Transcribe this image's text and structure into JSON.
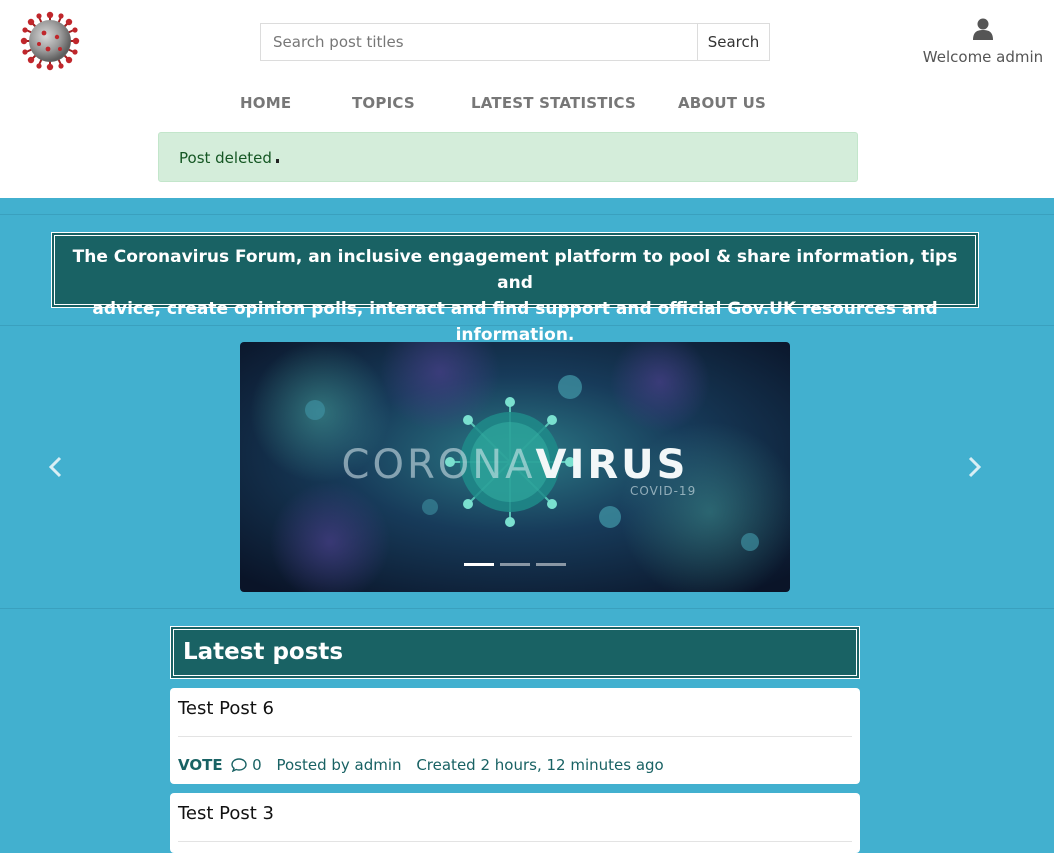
{
  "header": {
    "logo_icon": "coronavirus-logo-icon",
    "search": {
      "placeholder": "Search post titles",
      "value": "",
      "button_label": "Search"
    },
    "user": {
      "icon": "user-icon",
      "welcome_text": "Welcome admin"
    }
  },
  "nav": {
    "items": [
      {
        "label": "HOME"
      },
      {
        "label": "TOPICS"
      },
      {
        "label": "LATEST STATISTICS"
      },
      {
        "label": "ABOUT US"
      }
    ]
  },
  "alert": {
    "message": "Post deleted"
  },
  "banner": {
    "line1": "The Coronavirus Forum, an inclusive engagement platform to pool & share information, tips and",
    "line2": "advice, create opinion polls, interact and find support and official Gov.UK resources and information."
  },
  "carousel": {
    "slide_title_light": "CORONA",
    "slide_title_bold": "VIRUS",
    "slide_subtitle": "COVID-19",
    "active_index": 0,
    "slide_count": 3
  },
  "latest_posts": {
    "heading": "Latest posts",
    "posts": [
      {
        "title": "Test Post 6",
        "vote_label": "VOTE",
        "comment_count": "0",
        "posted_by": "Posted by admin",
        "created": "Created 2 hours, 12 minutes ago"
      },
      {
        "title": "Test Post 3"
      }
    ]
  },
  "colors": {
    "page_background": "#42b0cf",
    "dark_teal": "#196264",
    "alert_background": "#d4edda",
    "alert_text": "#155724"
  }
}
